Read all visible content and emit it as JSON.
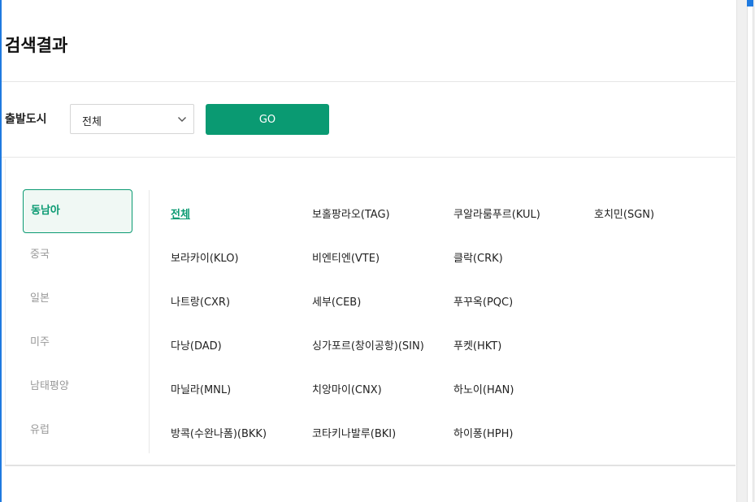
{
  "page": {
    "title": "검색결과"
  },
  "filter": {
    "label": "출발도시",
    "select_value": "전체",
    "go_label": "GO"
  },
  "regions": [
    {
      "label": "동남아",
      "active": true
    },
    {
      "label": "중국",
      "active": false
    },
    {
      "label": "일본",
      "active": false
    },
    {
      "label": "미주",
      "active": false
    },
    {
      "label": "남태평양",
      "active": false
    },
    {
      "label": "유럽",
      "active": false
    }
  ],
  "cities": [
    [
      "전체",
      "보홀팡라오(TAG)",
      "쿠알라룸푸르(KUL)",
      "호치민(SGN)"
    ],
    [
      "보라카이(KLO)",
      "비엔티엔(VTE)",
      "클락(CRK)"
    ],
    [
      "나트랑(CXR)",
      "세부(CEB)",
      "푸꾸옥(PQC)"
    ],
    [
      "다낭(DAD)",
      "싱가포르(창이공항)(SIN)",
      "푸켓(HKT)"
    ],
    [
      "마닐라(MNL)",
      "치앙마이(CNX)",
      "하노이(HAN)"
    ],
    [
      "방콕(수완나폼)(BKK)",
      "코타키나발루(BKI)",
      "하이퐁(HPH)"
    ]
  ],
  "active_city": "전체",
  "colors": {
    "accent": "#0a9a72",
    "active_bg": "#f0f8f4",
    "inactive_text": "#999999"
  },
  "icons": {
    "select_chevron": "chevron-down-icon"
  }
}
